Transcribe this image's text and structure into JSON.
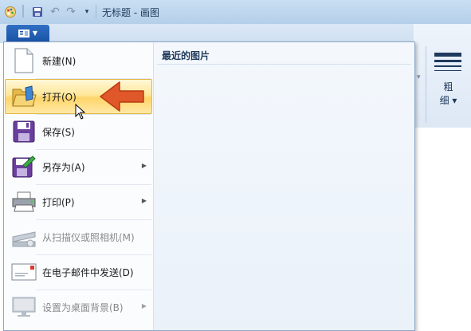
{
  "window": {
    "title": "无标题 - 画图"
  },
  "app_menu": {
    "button_icon": "app-menu-icon"
  },
  "menu": {
    "items": [
      {
        "label": "新建(N)",
        "icon": "new-file-icon",
        "submenu": false,
        "disabled": false
      },
      {
        "label": "打开(O)",
        "icon": "open-folder-icon",
        "submenu": false,
        "disabled": false,
        "highlighted": true
      },
      {
        "label": "保存(S)",
        "icon": "save-icon",
        "submenu": false,
        "disabled": false
      },
      {
        "label": "另存为(A)",
        "icon": "save-as-icon",
        "submenu": true,
        "disabled": false
      },
      {
        "label": "打印(P)",
        "icon": "printer-icon",
        "submenu": true,
        "disabled": false
      },
      {
        "label": "从扫描仪或照相机(M)",
        "icon": "scanner-icon",
        "submenu": false,
        "disabled": true
      },
      {
        "label": "在电子邮件中发送(D)",
        "icon": "email-icon",
        "submenu": false,
        "disabled": false
      },
      {
        "label": "设置为桌面背景(B)",
        "icon": "desktop-background-icon",
        "submenu": true,
        "disabled": true
      }
    ],
    "recent_title": "最近的图片"
  },
  "ribbon": {
    "thickness_label_1": "粗",
    "thickness_label_2": "细 ▾"
  },
  "colors": {
    "highlight": "#ffd56a",
    "annotation_arrow": "#e0572a",
    "menu_button": "#1b54a6"
  }
}
